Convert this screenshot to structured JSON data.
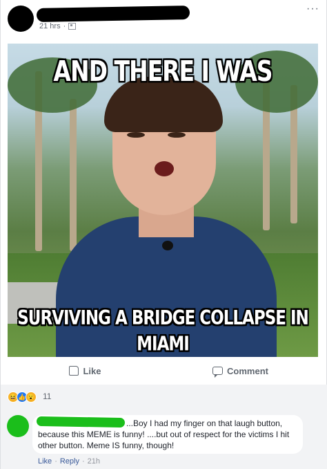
{
  "post": {
    "timestamp": "21 hrs",
    "privacy_icon": "friends-icon",
    "more_label": "···"
  },
  "meme": {
    "top_text": "AND THERE I WAS",
    "bottom_text": "SURVIVING A BRIDGE COLLAPSE IN MIAMI"
  },
  "actions": {
    "like_label": "Like",
    "comment_label": "Comment"
  },
  "reactions": {
    "icons": [
      "haha",
      "like",
      "wow"
    ],
    "count": "11"
  },
  "comment": {
    "text": "...Boy I had my finger on that laugh button, because this MEME is funny! ....but out of respect for the victims I hit other button. Meme IS funny, though!",
    "like_label": "Like",
    "reply_label": "Reply",
    "time": "21h"
  }
}
